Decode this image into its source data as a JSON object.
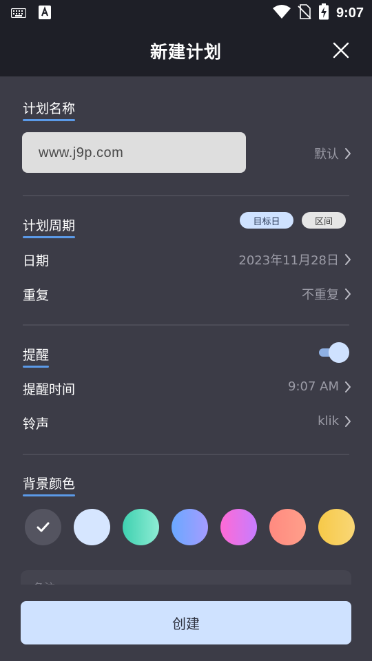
{
  "status_bar": {
    "time": "9:07",
    "icons": [
      "keyboard-icon",
      "a-icon",
      "wifi-icon",
      "no-sim-icon",
      "battery-charging-icon"
    ]
  },
  "header": {
    "title": "新建计划",
    "close_icon": "close-icon"
  },
  "plan_name": {
    "label": "计划名称",
    "input_value": "www.j9p.com",
    "default_label": "默认"
  },
  "plan_period": {
    "label": "计划周期",
    "chips": [
      {
        "label": "目标日",
        "active": true
      },
      {
        "label": "区间",
        "active": false
      }
    ],
    "rows": [
      {
        "label": "日期",
        "value": "2023年11月28日"
      },
      {
        "label": "重复",
        "value": "不重复"
      }
    ]
  },
  "reminder": {
    "label": "提醒",
    "enabled": true,
    "rows": [
      {
        "label": "提醒时间",
        "value": "9:07 AM"
      },
      {
        "label": "铃声",
        "value": "klik"
      }
    ]
  },
  "background_color": {
    "label": "背景颜色",
    "selected_index": 0,
    "swatches": [
      {
        "name": "dark",
        "colors": [
          "#545460",
          "#545460"
        ]
      },
      {
        "name": "light-blue",
        "colors": [
          "#d6e6ff",
          "#d6e6ff"
        ]
      },
      {
        "name": "teal",
        "colors": [
          "#3fd1b0",
          "#8eecd4"
        ]
      },
      {
        "name": "blue-purple",
        "colors": [
          "#6aa8ff",
          "#a59cff"
        ]
      },
      {
        "name": "pink",
        "colors": [
          "#ff6ad5",
          "#c77dff"
        ]
      },
      {
        "name": "coral",
        "colors": [
          "#ff8a80",
          "#ff9f8a"
        ]
      },
      {
        "name": "yellow",
        "colors": [
          "#f7c948",
          "#f9d776"
        ]
      }
    ]
  },
  "notes": {
    "placeholder": "备注"
  },
  "actions": {
    "create_label": "创建"
  },
  "colors": {
    "accent": "#5b9ae8",
    "button_bg": "#cfe2ff",
    "page_bg": "#3c3c47",
    "header_bg": "#1e1f27"
  }
}
